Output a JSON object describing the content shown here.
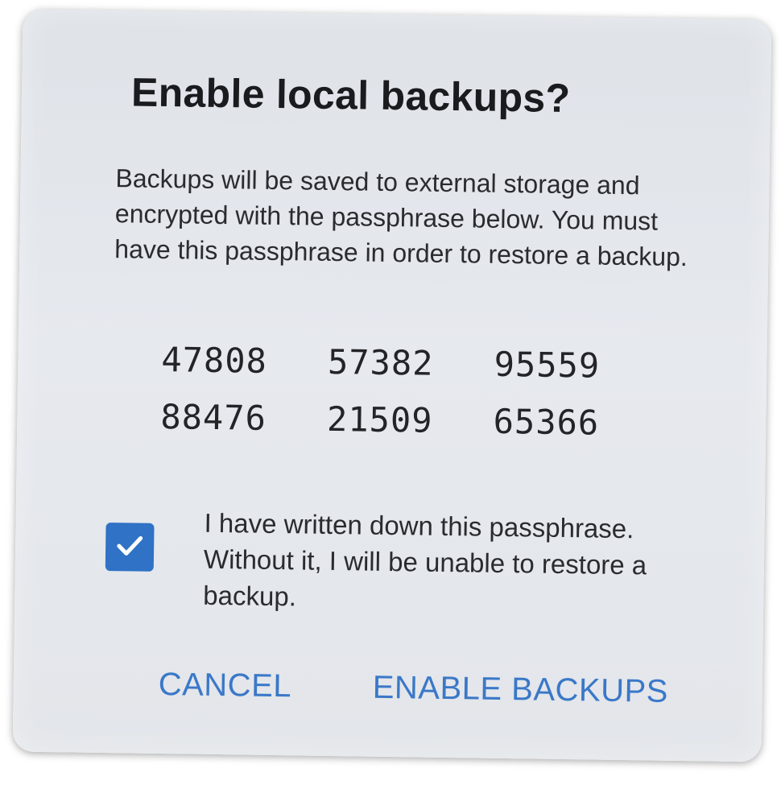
{
  "dialog": {
    "title": "Enable local backups?",
    "message": "Backups will be saved to external storage and encrypted with the passphrase below. You must have this passphrase in order to restore a backup.",
    "passphrase": [
      "47808",
      "57382",
      "95559",
      "88476",
      "21509",
      "65366"
    ],
    "checkbox": {
      "checked": true,
      "label": "I have written down this passphrase. Without it, I will be unable to restore a backup."
    },
    "buttons": {
      "cancel": "CANCEL",
      "confirm": "ENABLE BACKUPS"
    }
  },
  "colors": {
    "accent": "#3a78c8",
    "checkbox_fill": "#2f72c6",
    "dialog_background": "#e3e6ea"
  },
  "icons": {
    "checkbox_mark": "check-icon"
  }
}
